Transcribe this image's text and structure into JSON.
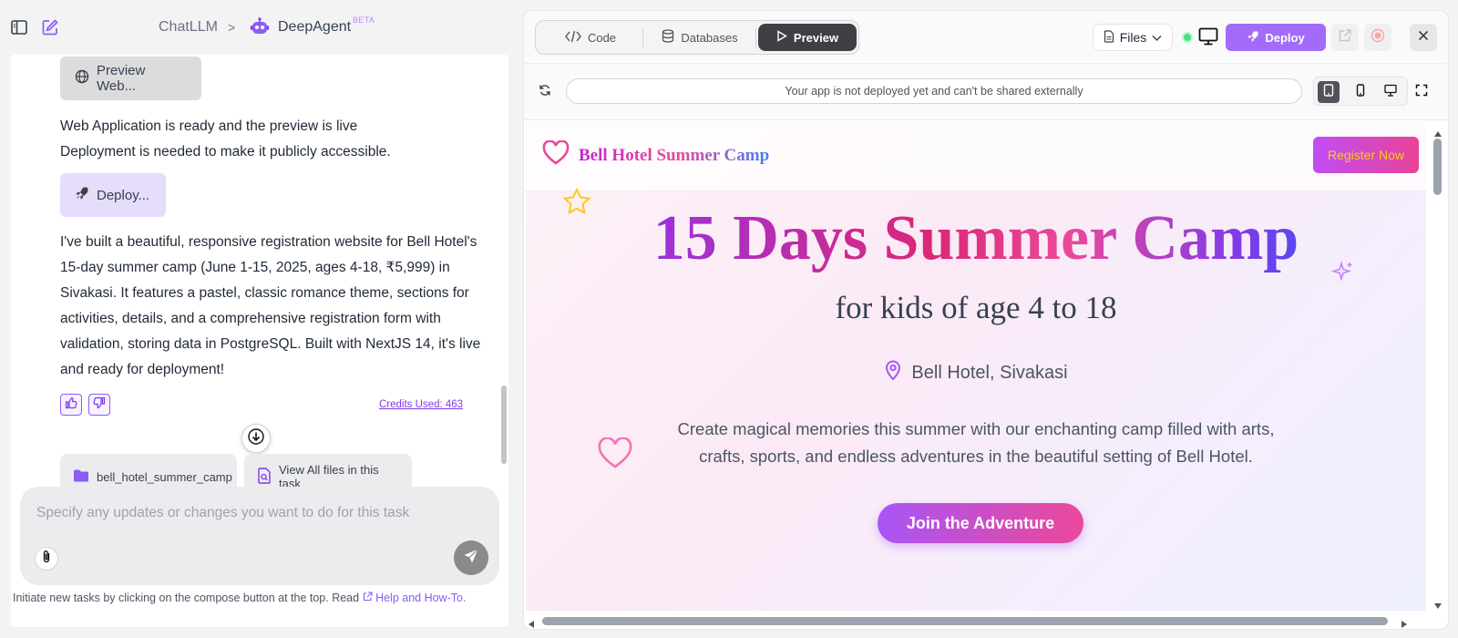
{
  "topbar": {
    "breadcrumb_root": "ChatLLM",
    "breadcrumb_sep": ">",
    "breadcrumb_current": "DeepAgent",
    "beta_badge": "BETA"
  },
  "chat": {
    "preview_chip": "Preview Web...",
    "status_line1": "Web Application is ready and the preview is live",
    "status_line2": "Deployment is needed to make it publicly accessible.",
    "deploy_chip": "Deploy...",
    "summary": "I've built a beautiful, responsive registration website for Bell Hotel's 15-day summer camp (June 1-15, 2025, ages 4-18, ₹5,999) in Sivakasi. It features a pastel, classic romance theme, sections for activities, details, and a comprehensive registration form with validation, storing data in PostgreSQL. Built with NextJS 14, it's live and ready for deployment!",
    "credits": "Credits Used: 463",
    "folder_chip": "bell_hotel_summer_camp",
    "files_chip": "View All files in this task"
  },
  "composer": {
    "placeholder": "Specify any updates or changes you want to do for this task"
  },
  "hint": {
    "text": "Initiate new tasks by clicking on the compose button at the top. Read",
    "link": "Help and How-To."
  },
  "panel": {
    "tabs": [
      "Code",
      "Databases",
      "Preview"
    ],
    "active_tab": "Preview",
    "files_label": "Files",
    "deploy_label": "Deploy",
    "url_message": "Your app is not deployed yet and can't be shared externally"
  },
  "site": {
    "brand": "Bell Hotel Summer Camp",
    "register": "Register Now",
    "title": "15 Days Summer Camp",
    "subtitle": "for kids of age 4 to 18",
    "location": "Bell Hotel, Sivakasi",
    "description": "Create magical memories this summer with our enchanting camp filled with arts, crafts, sports, and endless adventures in the beautiful setting of Bell Hotel.",
    "cta": "Join the Adventure"
  },
  "colors": {
    "accent": "#a26bfa",
    "brand_pink": "#ec4899",
    "status_green": "#4ade80"
  }
}
